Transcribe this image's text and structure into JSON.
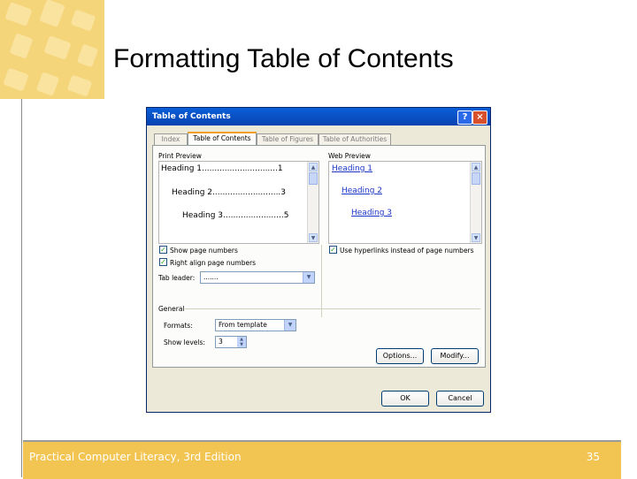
{
  "slide": {
    "title": "Formatting Table of Contents",
    "footer_text": "Practical Computer Literacy, 3rd Edition",
    "page_number": "35"
  },
  "dialog": {
    "title": "Table of Contents",
    "help_glyph": "?",
    "close_glyph": "×",
    "tabs": [
      "Index",
      "Table of Contents",
      "Table of Figures",
      "Table of Authorities"
    ],
    "active_tab": "Table of Contents",
    "print_preview": {
      "label": "Print Preview",
      "lines": [
        {
          "text": "Heading 1",
          "dots": "..............................",
          "page": "1"
        },
        {
          "text": "Heading 2",
          "dots": "...........................",
          "page": "3"
        },
        {
          "text": "Heading 3",
          "dots": "........................",
          "page": "5"
        }
      ]
    },
    "web_preview": {
      "label": "Web Preview",
      "lines": [
        "Heading 1",
        "Heading 2",
        "Heading 3"
      ]
    },
    "show_page_numbers": {
      "label": "Show page numbers",
      "checked": true
    },
    "right_align_page_numbers": {
      "label": "Right align page numbers",
      "checked": true
    },
    "use_hyperlinks": {
      "label": "Use hyperlinks instead of page numbers",
      "checked": true
    },
    "tab_leader": {
      "label": "Tab leader:",
      "value": "......."
    },
    "general": {
      "label": "General",
      "formats": {
        "label": "Formats:",
        "value": "From template"
      },
      "show_levels": {
        "label": "Show levels:",
        "value": "3"
      }
    },
    "buttons": {
      "options": "Options...",
      "modify": "Modify...",
      "ok": "OK",
      "cancel": "Cancel"
    },
    "check_glyph": "✓",
    "scroll_up_glyph": "▲",
    "scroll_down_glyph": "▼",
    "dropdown_glyph": "▼"
  }
}
